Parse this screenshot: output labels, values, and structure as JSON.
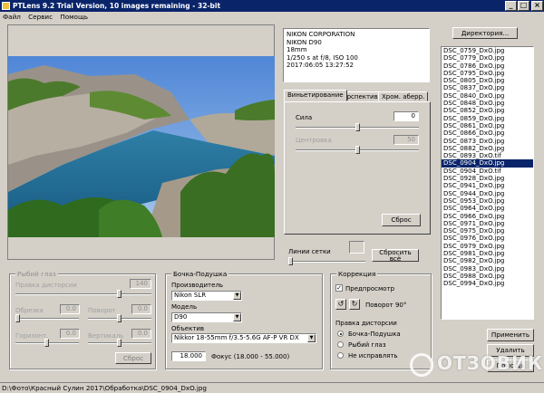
{
  "window": {
    "title": "PTLens 9.2 Trial Version, 10 images remaining - 32-bit",
    "minimize": "_",
    "maximize": "□",
    "close": "×"
  },
  "menu": [
    "Файл",
    "Сервис",
    "Помощь"
  ],
  "exif": [
    "NIKON CORPORATION",
    "NIKON D90",
    "18mm",
    "1/250 s at f/8, ISO 100",
    "2017:06:05 13:27:52"
  ],
  "tabs": [
    "Виньетирование",
    "Перспектива",
    "Хром. аберр."
  ],
  "vignette": {
    "strength_label": "Сила",
    "strength_value": "0",
    "center_label": "Центровка",
    "center_value": "50",
    "reset_label": "Сброс"
  },
  "grid": {
    "label": "Линии сетки",
    "reset_all_label": "Сбросить всё"
  },
  "fisheye": {
    "title": "Рыбий глаз",
    "distortion_label": "Правка дисторсии",
    "distortion_value": "140",
    "crop_label": "Обрезка",
    "crop_value": "0.0",
    "rotate_label": "Поворот",
    "rotate_value": "0.0",
    "horizontal_label": "Горизонт.",
    "horizontal_value": "0.0",
    "vertical_label": "Вертикаль",
    "vertical_value": "0.0",
    "reset_label": "Сброс"
  },
  "barrel": {
    "title": "Бочка-Подушка",
    "maker_label": "Производитель",
    "maker_value": "Nikon SLR",
    "model_label": "Модель",
    "model_value": "D90",
    "lens_label": "Объектив",
    "lens_value": "Nikkor 18-55mm f/3.5-5.6G AF-P VR DX",
    "focal_value": "18.000",
    "focal_label": "Фокус (18.000 - 55.000)"
  },
  "correction": {
    "title": "Коррекция",
    "preview_label": "Предпросмотр",
    "preview_checked": true,
    "rotate_label": "Поворот 90°",
    "distortion_title": "Правка дисторсии",
    "options": [
      "Бочка-Подушка",
      "Рыбий глаз",
      "Не исправлять"
    ],
    "selected": 0
  },
  "dir_button": "Директория...",
  "files": [
    "DSC_0759_DxO.jpg",
    "DSC_0779_DxO.jpg",
    "DSC_0786_DxO.jpg",
    "DSC_0795_DxO.jpg",
    "DSC_0805_DxO.jpg",
    "DSC_0837_DxO.jpg",
    "DSC_0840_DxO.jpg",
    "DSC_0848_DxO.jpg",
    "DSC_0852_DxO.jpg",
    "DSC_0859_DxO.jpg",
    "DSC_0861_DxO.jpg",
    "DSC_0866_DxO.jpg",
    "DSC_0873_DxO.jpg",
    "DSC_0882_DxO.jpg",
    "DSC_0893_DxO.tif",
    "DSC_0904_DxO.jpg",
    "DSC_0904_DxO.tif",
    "DSC_0928_DxO.jpg",
    "DSC_0941_DxO.jpg",
    "DSC_0944_DxO.jpg",
    "DSC_0953_DxO.jpg",
    "DSC_0964_DxO.jpg",
    "DSC_0966_DxO.jpg",
    "DSC_0971_DxO.jpg",
    "DSC_0975_DxO.jpg",
    "DSC_0976_DxO.jpg",
    "DSC_0979_DxO.jpg",
    "DSC_0981_DxO.jpg",
    "DSC_0982_DxO.jpg",
    "DSC_0983_DxO.jpg",
    "DSC_0988_DxO.jpg",
    "DSC_0994_DxO.jpg"
  ],
  "selected_file": 15,
  "apply_button": "Применить",
  "delete_button": "Удалить",
  "help_button": "Помощь",
  "status": "D:\\Фото\\Красный Сулин 2017\\Обработка\\DSC_0904_DxO.jpg",
  "watermark": "ОТЗОВИК"
}
